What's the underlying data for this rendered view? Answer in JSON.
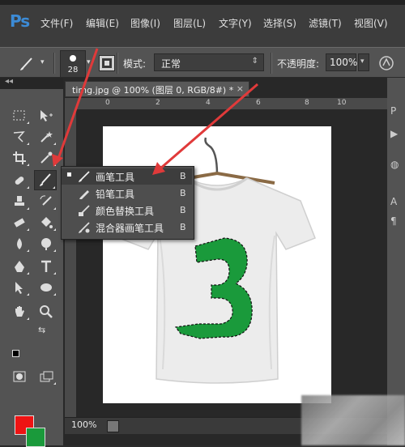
{
  "app": {
    "logo": "Ps"
  },
  "menu": [
    "文件(F)",
    "编辑(E)",
    "图像(I)",
    "图层(L)",
    "文字(Y)",
    "选择(S)",
    "滤镜(T)",
    "视图(V)"
  ],
  "options": {
    "brush_size": "28",
    "mode_label": "模式:",
    "mode_value": "正常",
    "opacity_label": "不透明度:",
    "opacity_value": "100%"
  },
  "document": {
    "tab_title": "timg.jpg @ 100% (图层 0, RGB/8#) *",
    "close": "×",
    "zoom": "100%",
    "ruler_ticks": [
      "0",
      "2",
      "4",
      "6",
      "8",
      "10"
    ]
  },
  "toolbox": {
    "collapse": "◂◂",
    "fg_color": "#ee1313",
    "bg_color": "#1a9a3b"
  },
  "flyout": [
    {
      "label": "画笔工具",
      "key": "B",
      "selected": true,
      "icon": "brush-icon"
    },
    {
      "label": "铅笔工具",
      "key": "B",
      "selected": false,
      "icon": "pencil-icon"
    },
    {
      "label": "颜色替换工具",
      "key": "B",
      "selected": false,
      "icon": "color-replacement-icon"
    },
    {
      "label": "混合器画笔工具",
      "key": "B",
      "selected": false,
      "icon": "mixer-brush-icon"
    }
  ],
  "right_strip": [
    "P",
    "▶",
    "◍",
    "A",
    "¶"
  ],
  "colors": {
    "annotation_arrow": "#e03a3a",
    "selection_fill": "#1a9a3b"
  }
}
